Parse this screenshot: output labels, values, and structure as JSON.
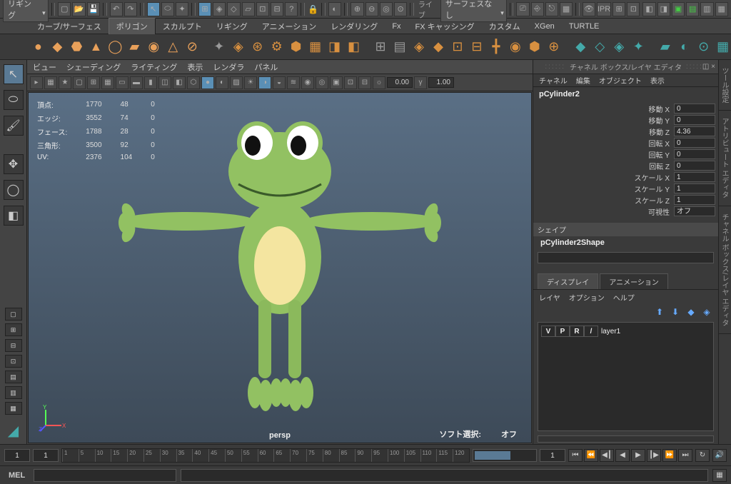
{
  "topbar": {
    "workspace": "リギング",
    "live_label": "ライブ",
    "surface_label": "サーフェスなし"
  },
  "menubar": {
    "tabs": [
      "カーブ/サーフェス",
      "ポリゴン",
      "スカルプト",
      "リギング",
      "アニメーション",
      "レンダリング",
      "Fx",
      "FX キャッシング",
      "カスタム",
      "XGen",
      "TURTLE"
    ],
    "active_index": 1
  },
  "viewport_menu": {
    "items": [
      "ビュー",
      "シェーディング",
      "ライティング",
      "表示",
      "レンダラ",
      "パネル"
    ]
  },
  "viewport_toolbar": {
    "exposure": "0.00",
    "gamma": "1.00"
  },
  "hud": {
    "rows": [
      {
        "label": "頂点:",
        "a": "1770",
        "b": "48",
        "c": "0"
      },
      {
        "label": "エッジ:",
        "a": "3552",
        "b": "74",
        "c": "0"
      },
      {
        "label": "フェース:",
        "a": "1788",
        "b": "28",
        "c": "0"
      },
      {
        "label": "三角形:",
        "a": "3500",
        "b": "92",
        "c": "0"
      },
      {
        "label": "UV:",
        "a": "2376",
        "b": "104",
        "c": "0"
      }
    ],
    "camera": "persp",
    "soft_select_label": "ソフト選択:",
    "soft_select_value": "オフ"
  },
  "channel_box": {
    "title": "チャネル ボックス/レイヤ エディタ",
    "menu": [
      "チャネル",
      "編集",
      "オブジェクト",
      "表示"
    ],
    "object": "pCylinder2",
    "attrs": [
      {
        "label": "移動 X",
        "value": "0"
      },
      {
        "label": "移動 Y",
        "value": "0"
      },
      {
        "label": "移動 Z",
        "value": "4.36"
      },
      {
        "label": "回転 X",
        "value": "0"
      },
      {
        "label": "回転 Y",
        "value": "0"
      },
      {
        "label": "回転 Z",
        "value": "0"
      },
      {
        "label": "スケール X",
        "value": "1"
      },
      {
        "label": "スケール Y",
        "value": "1"
      },
      {
        "label": "スケール Z",
        "value": "1"
      },
      {
        "label": "可視性",
        "value": "オフ"
      }
    ],
    "shape_header": "シェイプ",
    "shape_name": "pCylinder2Shape"
  },
  "layers": {
    "tabs": [
      "ディスプレイ",
      "アニメーション"
    ],
    "menu": [
      "レイヤ",
      "オプション",
      "ヘルプ"
    ],
    "columns": [
      "V",
      "P",
      "R"
    ],
    "row_slash": "/",
    "row_name": "layer1"
  },
  "right_tabs": [
    "ツール設定",
    "アトリビュート エディタ",
    "チャネル ボックス/レイヤ エディタ"
  ],
  "timeline": {
    "start": "1",
    "start2": "1",
    "ticks": [
      "1",
      "5",
      "10",
      "15",
      "20",
      "25",
      "30",
      "35",
      "40",
      "45",
      "50",
      "55",
      "60",
      "65",
      "70",
      "75",
      "80",
      "85",
      "90",
      "95",
      "100",
      "105",
      "110",
      "115",
      "120"
    ],
    "end2": "1",
    "end": "1"
  },
  "statusbar": {
    "lang": "MEL"
  }
}
